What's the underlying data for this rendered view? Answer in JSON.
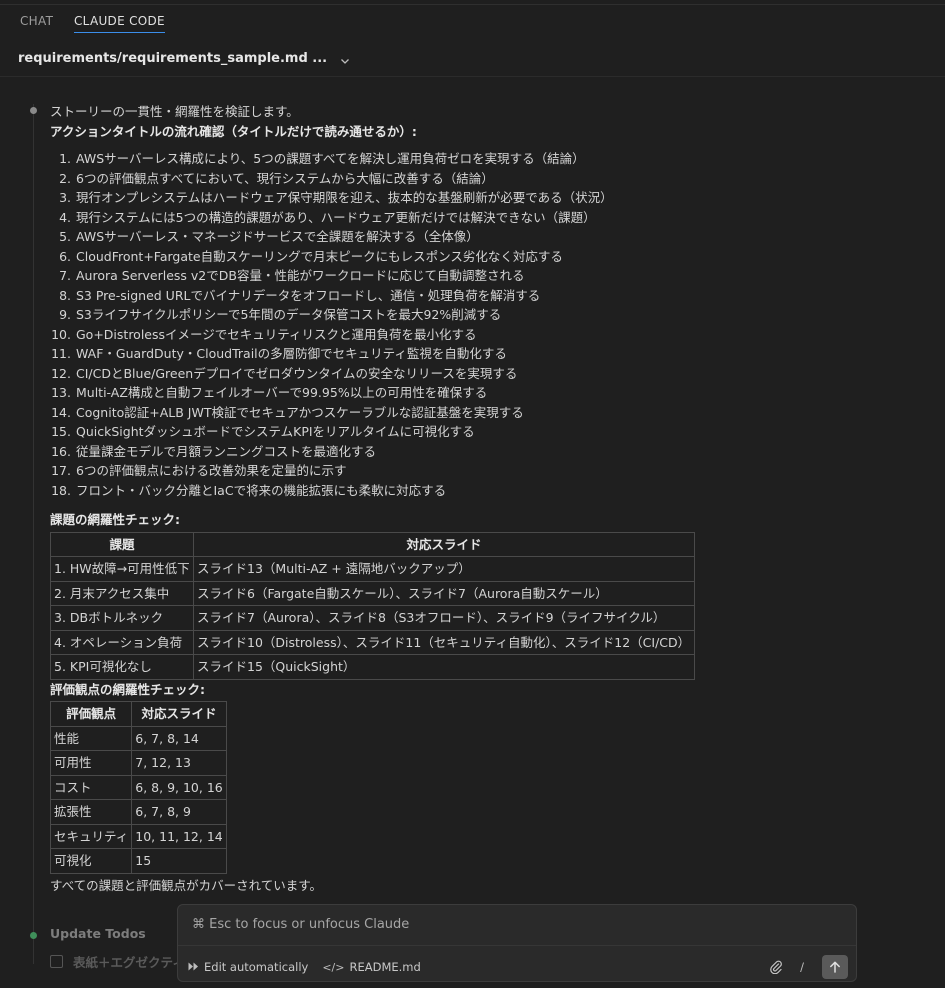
{
  "tabs": [
    {
      "label": "CHAT",
      "active": false
    },
    {
      "label": "CLAUDE CODE",
      "active": true
    }
  ],
  "file": {
    "path": "requirements/requirements_sample.md ..."
  },
  "message": {
    "intro": "ストーリーの一貫性・網羅性を検証します。",
    "actions_title": "アクションタイトルの流れ確認（タイトルだけで読み通せるか）:",
    "actions": [
      {
        "num": "1.",
        "text": "AWSサーバーレス構成により、5つの課題すべてを解決し運用負荷ゼロを実現する（結論）"
      },
      {
        "num": "2.",
        "text": "6つの評価観点すべてにおいて、現行システムから大幅に改善する（結論）"
      },
      {
        "num": "3.",
        "text": "現行オンプレシステムはハードウェア保守期限を迎え、抜本的な基盤刷新が必要である（状況）"
      },
      {
        "num": "4.",
        "text": "現行システムには5つの構造的課題があり、ハードウェア更新だけでは解決できない（課題）"
      },
      {
        "num": "5.",
        "text": "AWSサーバーレス・マネージドサービスで全課題を解決する（全体像）"
      },
      {
        "num": "6.",
        "text": "CloudFront+Fargate自動スケーリングで月末ピークにもレスポンス劣化なく対応する"
      },
      {
        "num": "7.",
        "text": "Aurora Serverless v2でDB容量・性能がワークロードに応じて自動調整される"
      },
      {
        "num": "8.",
        "text": "S3 Pre-signed URLでバイナリデータをオフロードし、通信・処理負荷を解消する"
      },
      {
        "num": "9.",
        "text": "S3ライフサイクルポリシーで5年間のデータ保管コストを最大92%削減する"
      },
      {
        "num": "10.",
        "text": "Go+Distrolessイメージでセキュリティリスクと運用負荷を最小化する"
      },
      {
        "num": "11.",
        "text": "WAF・GuardDuty・CloudTrailの多層防御でセキュリティ監視を自動化する"
      },
      {
        "num": "12.",
        "text": "CI/CDとBlue/Greenデプロイでゼロダウンタイムの安全なリリースを実現する"
      },
      {
        "num": "13.",
        "text": "Multi-AZ構成と自動フェイルオーバーで99.95%以上の可用性を確保する"
      },
      {
        "num": "14.",
        "text": "Cognito認証+ALB JWT検証でセキュアかつスケーラブルな認証基盤を実現する"
      },
      {
        "num": "15.",
        "text": "QuickSightダッシュボードでシステムKPIをリアルタイムに可視化する"
      },
      {
        "num": "16.",
        "text": "従量課金モデルで月額ランニングコストを最適化する"
      },
      {
        "num": "17.",
        "text": "6つの評価観点における改善効果を定量的に示す"
      },
      {
        "num": "18.",
        "text": "フロント・バック分離とIaCで将来の機能拡張にも柔軟に対応する"
      }
    ],
    "issues_title": "課題の網羅性チェック:",
    "issues_table": {
      "headers": [
        "課題",
        "対応スライド"
      ],
      "rows": [
        [
          "1. HW故障→可用性低下",
          "スライド13（Multi-AZ + 遠隔地バックアップ）"
        ],
        [
          "2. 月末アクセス集中",
          "スライド6（Fargate自動スケール）、スライド7（Aurora自動スケール）"
        ],
        [
          "3. DBボトルネック",
          "スライド7（Aurora）、スライド8（S3オフロード）、スライド9（ライフサイクル）"
        ],
        [
          "4. オペレーション負荷",
          "スライド10（Distroless）、スライド11（セキュリティ自動化）、スライド12（CI/CD）"
        ],
        [
          "5. KPI可視化なし",
          "スライド15（QuickSight）"
        ]
      ]
    },
    "criteria_title": "評価観点の網羅性チェック:",
    "criteria_table": {
      "headers": [
        "評価観点",
        "対応スライド"
      ],
      "rows": [
        [
          "性能",
          "6, 7, 8, 14"
        ],
        [
          "可用性",
          "7, 12, 13"
        ],
        [
          "コスト",
          "6, 8, 9, 10, 16"
        ],
        [
          "拡張性",
          "6, 7, 8, 9"
        ],
        [
          "セキュリティ",
          "10, 11, 12, 14"
        ],
        [
          "可視化",
          "15"
        ]
      ]
    },
    "summary": "すべての課題と評価観点がカバーされています。"
  },
  "todos": {
    "label": "Update Todos",
    "first_item": "表紙＋エグゼクティ"
  },
  "input": {
    "placeholder": "⌘ Esc to focus or unfocus Claude",
    "edit_mode": "Edit automatically",
    "file_chip": "README.md",
    "slash": "/"
  },
  "colors": {
    "accent": "#3b8eea",
    "bg": "#1f1f1f",
    "status_dot": "#3f8f5a"
  }
}
